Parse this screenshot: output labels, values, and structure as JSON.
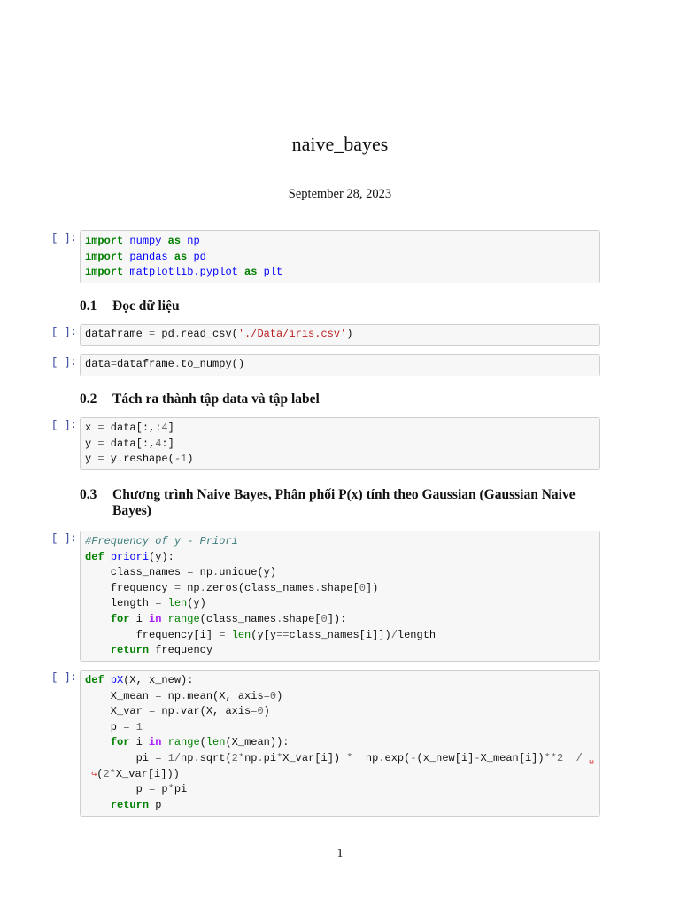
{
  "document": {
    "title": "naive_bayes",
    "date": "September 28, 2023",
    "page_number": "1"
  },
  "prompt": "[ ]:",
  "headings": [
    {
      "number": "0.1",
      "text": "Đọc dữ liệu"
    },
    {
      "number": "0.2",
      "text": "Tách ra thành tập data và tập label"
    },
    {
      "number": "0.3",
      "text": "Chương trình Naive Bayes, Phân phối P(x) tính theo Gaussian (Gaussian Naive Bayes)"
    }
  ],
  "cells": [
    [
      [
        {
          "t": "import",
          "c": "k"
        },
        {
          "t": " "
        },
        {
          "t": "numpy",
          "c": "n"
        },
        {
          "t": " "
        },
        {
          "t": "as",
          "c": "k"
        },
        {
          "t": " "
        },
        {
          "t": "np",
          "c": "n"
        }
      ],
      [
        {
          "t": "import",
          "c": "k"
        },
        {
          "t": " "
        },
        {
          "t": "pandas",
          "c": "n"
        },
        {
          "t": " "
        },
        {
          "t": "as",
          "c": "k"
        },
        {
          "t": " "
        },
        {
          "t": "pd",
          "c": "n"
        }
      ],
      [
        {
          "t": "import",
          "c": "k"
        },
        {
          "t": " "
        },
        {
          "t": "matplotlib.pyplot",
          "c": "n"
        },
        {
          "t": " "
        },
        {
          "t": "as",
          "c": "k"
        },
        {
          "t": " "
        },
        {
          "t": "plt",
          "c": "n"
        }
      ]
    ],
    [
      [
        {
          "t": "dataframe "
        },
        {
          "t": "=",
          "c": "o"
        },
        {
          "t": " pd"
        },
        {
          "t": ".",
          "c": "o"
        },
        {
          "t": "read_csv("
        },
        {
          "t": "'./Data/iris.csv'",
          "c": "s"
        },
        {
          "t": ")"
        }
      ]
    ],
    [
      [
        {
          "t": "data"
        },
        {
          "t": "=",
          "c": "o"
        },
        {
          "t": "dataframe"
        },
        {
          "t": ".",
          "c": "o"
        },
        {
          "t": "to_numpy()"
        }
      ]
    ],
    [
      [
        {
          "t": "x "
        },
        {
          "t": "=",
          "c": "o"
        },
        {
          "t": " data[:,:"
        },
        {
          "t": "4",
          "c": "m"
        },
        {
          "t": "]"
        }
      ],
      [
        {
          "t": "y "
        },
        {
          "t": "=",
          "c": "o"
        },
        {
          "t": " data[:,"
        },
        {
          "t": "4",
          "c": "m"
        },
        {
          "t": ":]"
        }
      ],
      [
        {
          "t": "y "
        },
        {
          "t": "=",
          "c": "o"
        },
        {
          "t": " y"
        },
        {
          "t": ".",
          "c": "o"
        },
        {
          "t": "reshape("
        },
        {
          "t": "-1",
          "c": "o"
        },
        {
          "t": ")"
        }
      ]
    ],
    [
      [
        {
          "t": "#Frequency of y - Priori",
          "c": "c"
        }
      ],
      [
        {
          "t": "def",
          "c": "k"
        },
        {
          "t": " "
        },
        {
          "t": "priori",
          "c": "n"
        },
        {
          "t": "(y):"
        }
      ],
      [
        {
          "t": "    class_names "
        },
        {
          "t": "=",
          "c": "o"
        },
        {
          "t": " np"
        },
        {
          "t": ".",
          "c": "o"
        },
        {
          "t": "unique(y)"
        }
      ],
      [
        {
          "t": "    frequency "
        },
        {
          "t": "=",
          "c": "o"
        },
        {
          "t": " np"
        },
        {
          "t": ".",
          "c": "o"
        },
        {
          "t": "zeros(class_names"
        },
        {
          "t": ".",
          "c": "o"
        },
        {
          "t": "shape["
        },
        {
          "t": "0",
          "c": "m"
        },
        {
          "t": "])"
        }
      ],
      [
        {
          "t": "    length "
        },
        {
          "t": "=",
          "c": "o"
        },
        {
          "t": " "
        },
        {
          "t": "len",
          "c": "b"
        },
        {
          "t": "(y)"
        }
      ],
      [
        {
          "t": "    "
        },
        {
          "t": "for",
          "c": "k"
        },
        {
          "t": " i "
        },
        {
          "t": "in",
          "c": "w"
        },
        {
          "t": " "
        },
        {
          "t": "range",
          "c": "b"
        },
        {
          "t": "(class_names"
        },
        {
          "t": ".",
          "c": "o"
        },
        {
          "t": "shape["
        },
        {
          "t": "0",
          "c": "m"
        },
        {
          "t": "]):"
        }
      ],
      [
        {
          "t": "        frequency[i] "
        },
        {
          "t": "=",
          "c": "o"
        },
        {
          "t": " "
        },
        {
          "t": "len",
          "c": "b"
        },
        {
          "t": "(y[y"
        },
        {
          "t": "==",
          "c": "o"
        },
        {
          "t": "class_names[i]])"
        },
        {
          "t": "/",
          "c": "o"
        },
        {
          "t": "length"
        }
      ],
      [
        {
          "t": "    "
        },
        {
          "t": "return",
          "c": "k"
        },
        {
          "t": " frequency"
        }
      ]
    ],
    [
      [
        {
          "t": "def",
          "c": "k"
        },
        {
          "t": " "
        },
        {
          "t": "pX",
          "c": "n"
        },
        {
          "t": "(X, x_new):"
        }
      ],
      [
        {
          "t": "    X_mean "
        },
        {
          "t": "=",
          "c": "o"
        },
        {
          "t": " np"
        },
        {
          "t": ".",
          "c": "o"
        },
        {
          "t": "mean(X, axis"
        },
        {
          "t": "=",
          "c": "o"
        },
        {
          "t": "0",
          "c": "m"
        },
        {
          "t": ")"
        }
      ],
      [
        {
          "t": "    X_var "
        },
        {
          "t": "=",
          "c": "o"
        },
        {
          "t": " np"
        },
        {
          "t": ".",
          "c": "o"
        },
        {
          "t": "var(X, axis"
        },
        {
          "t": "=",
          "c": "o"
        },
        {
          "t": "0",
          "c": "m"
        },
        {
          "t": ")"
        }
      ],
      [
        {
          "t": "    p "
        },
        {
          "t": "=",
          "c": "o"
        },
        {
          "t": " "
        },
        {
          "t": "1",
          "c": "m"
        }
      ],
      [
        {
          "t": "    "
        },
        {
          "t": "for",
          "c": "k"
        },
        {
          "t": " i "
        },
        {
          "t": "in",
          "c": "w"
        },
        {
          "t": " "
        },
        {
          "t": "range",
          "c": "b"
        },
        {
          "t": "("
        },
        {
          "t": "len",
          "c": "b"
        },
        {
          "t": "(X_mean)):"
        }
      ],
      [
        {
          "t": "        pi "
        },
        {
          "t": "=",
          "c": "o"
        },
        {
          "t": " "
        },
        {
          "t": "1",
          "c": "m"
        },
        {
          "t": "/",
          "c": "o"
        },
        {
          "t": "np"
        },
        {
          "t": ".",
          "c": "o"
        },
        {
          "t": "sqrt("
        },
        {
          "t": "2",
          "c": "m"
        },
        {
          "t": "*",
          "c": "o"
        },
        {
          "t": "np"
        },
        {
          "t": ".",
          "c": "o"
        },
        {
          "t": "pi"
        },
        {
          "t": "*",
          "c": "o"
        },
        {
          "t": "X_var[i]) "
        },
        {
          "t": "*",
          "c": "o"
        },
        {
          "t": "  np"
        },
        {
          "t": ".",
          "c": "o"
        },
        {
          "t": "exp("
        },
        {
          "t": "-",
          "c": "o"
        },
        {
          "t": "(x_new[i]"
        },
        {
          "t": "-",
          "c": "o"
        },
        {
          "t": "X_mean[i])"
        },
        {
          "t": "**",
          "c": "o"
        },
        {
          "t": "2",
          "c": "m"
        },
        {
          "t": "  "
        },
        {
          "t": "/",
          "c": "o"
        },
        {
          "t": " "
        },
        {
          "t": "␣",
          "c": "r"
        }
      ],
      [
        {
          "t": " "
        },
        {
          "t": "↪",
          "c": "r"
        },
        {
          "t": "("
        },
        {
          "t": "2",
          "c": "m"
        },
        {
          "t": "*",
          "c": "o"
        },
        {
          "t": "X_var[i]))"
        }
      ],
      [
        {
          "t": "        p "
        },
        {
          "t": "=",
          "c": "o"
        },
        {
          "t": " p"
        },
        {
          "t": "*",
          "c": "o"
        },
        {
          "t": "pi"
        }
      ],
      [
        {
          "t": "    "
        },
        {
          "t": "return",
          "c": "k"
        },
        {
          "t": " p"
        }
      ]
    ]
  ],
  "colors": {
    "keyword": "#008000",
    "name": "#0000FF",
    "string": "#BA2121",
    "comment": "#3D7B7B",
    "prompt": "#303F9F",
    "cell_bg": "#f7f7f7"
  }
}
